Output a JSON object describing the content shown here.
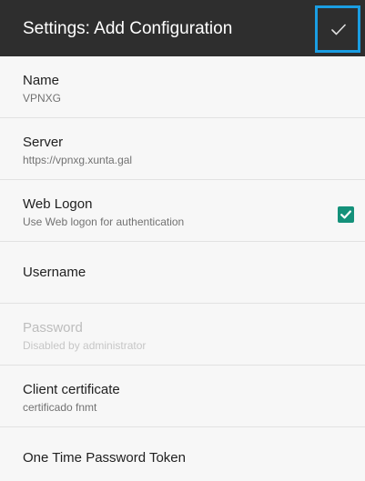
{
  "appbar": {
    "title": "Settings: Add Configuration",
    "save_icon": "checkmark-icon"
  },
  "rows": [
    {
      "title": "Name",
      "subtitle": "VPNXG",
      "enabled": true
    },
    {
      "title": "Server",
      "subtitle": "https://vpnxg.xunta.gal",
      "enabled": true
    },
    {
      "title": "Web Logon",
      "subtitle": "Use Web logon for authentication",
      "enabled": true,
      "checked": true
    },
    {
      "title": "Username",
      "enabled": true
    },
    {
      "title": "Password",
      "subtitle": "Disabled by administrator",
      "enabled": false
    },
    {
      "title": "Client certificate",
      "subtitle": "certificado fnmt",
      "enabled": true
    },
    {
      "title": "One Time Password Token",
      "enabled": true
    }
  ],
  "colors": {
    "appbar_bg": "#2e2e2e",
    "highlight_border": "#1a9ee3",
    "checkbox_fill": "#14917a",
    "background": "#f7f7f7"
  }
}
